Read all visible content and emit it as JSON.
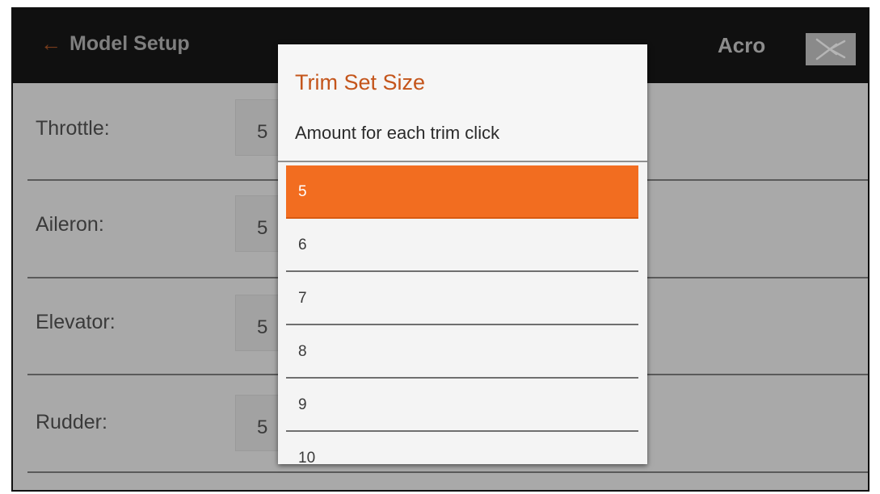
{
  "header": {
    "back_arrow": "←",
    "title": "Model Setup",
    "model_type": "Acro",
    "aircraft_icon": "airplane-icon"
  },
  "rows": [
    {
      "label": "Throttle:",
      "value": "5"
    },
    {
      "label": "Aileron:",
      "value": "5"
    },
    {
      "label": "Elevator:",
      "value": "5"
    },
    {
      "label": "Rudder:",
      "value": "5"
    }
  ],
  "dialog": {
    "title": "Trim Set Size",
    "subtitle": "Amount for each trim click",
    "options": [
      {
        "label": "5",
        "selected": true
      },
      {
        "label": "6",
        "selected": false
      },
      {
        "label": "7",
        "selected": false
      },
      {
        "label": "8",
        "selected": false
      },
      {
        "label": "9",
        "selected": false
      },
      {
        "label": "10",
        "selected": false
      }
    ]
  },
  "colors": {
    "accent": "#f26d20",
    "title_accent": "#c4551b",
    "header_bg": "#101010",
    "dimmed_bg": "#a9a9a9"
  }
}
